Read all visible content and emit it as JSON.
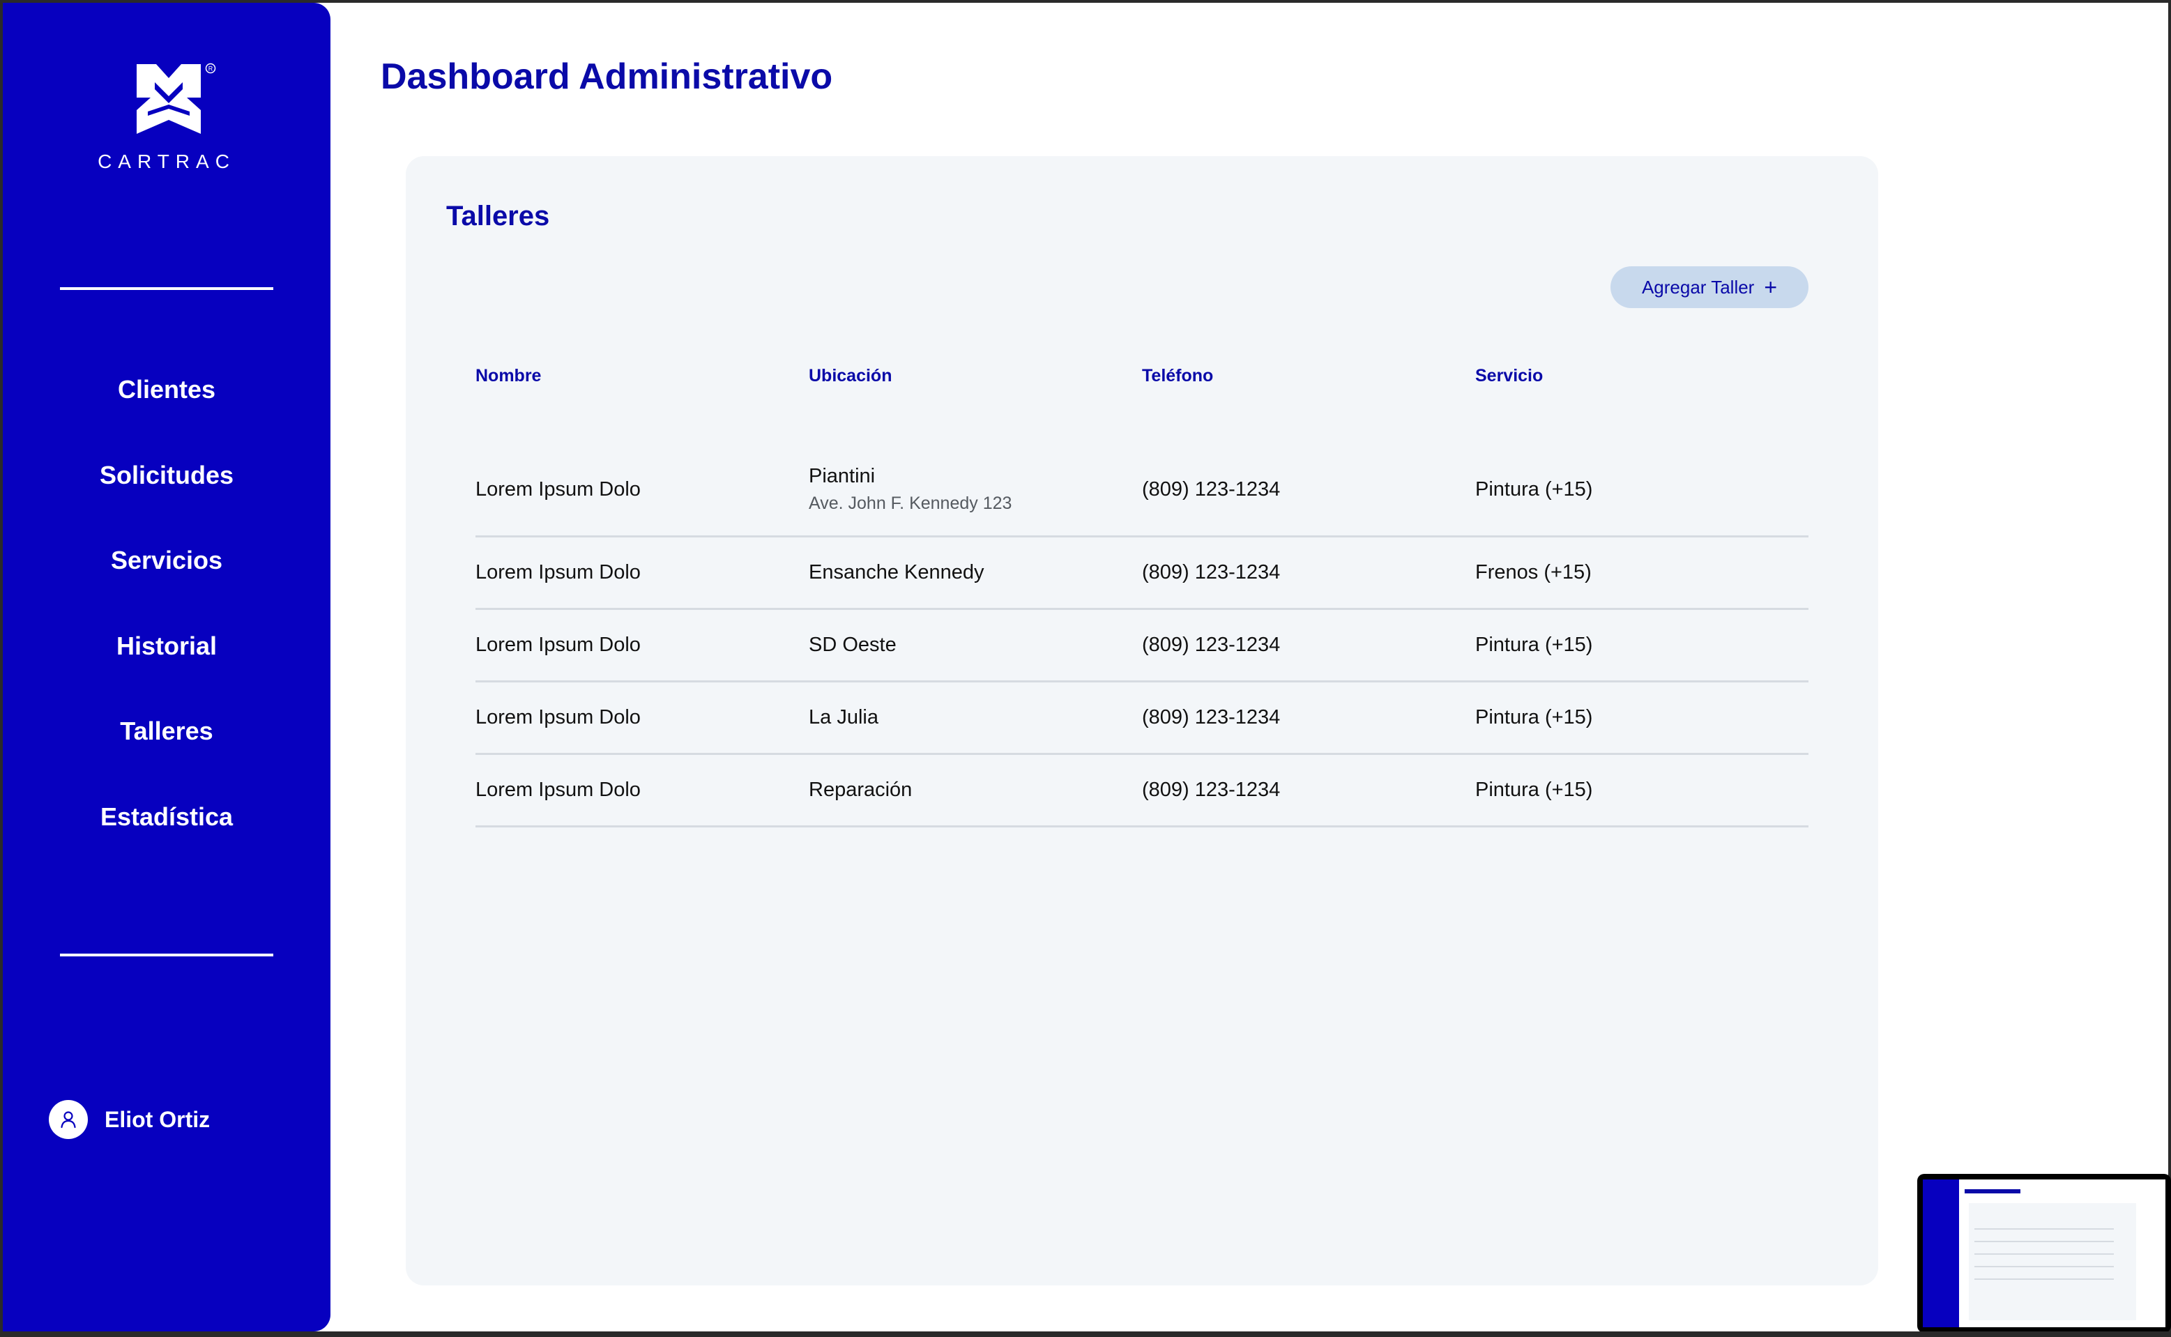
{
  "brand": {
    "name": "CARTRAC",
    "primary_color": "#0700bf",
    "accent_text_color": "#0a0aa8",
    "logo_icon": "cartrac-logo-icon"
  },
  "page": {
    "title": "Dashboard Administrativo"
  },
  "sidebar": {
    "items": [
      {
        "label": "Clientes"
      },
      {
        "label": "Solicitudes"
      },
      {
        "label": "Servicios"
      },
      {
        "label": "Historial"
      },
      {
        "label": "Talleres"
      },
      {
        "label": "Estadística"
      }
    ],
    "user": {
      "name": "Eliot Ortiz",
      "icon": "user-icon"
    }
  },
  "section": {
    "title": "Talleres",
    "add_button_label": "Agregar Taller",
    "add_button_icon": "plus-icon"
  },
  "table": {
    "headers": [
      "Nombre",
      "Ubicación",
      "Teléfono",
      "Servicio"
    ],
    "rows": [
      {
        "nombre": "Lorem Ipsum Dolo",
        "ubicacion": "Piantini",
        "ubicacion_detalle": "Ave. John F. Kennedy 123",
        "telefono": "(809) 123-1234",
        "servicio": "Pintura (+15)"
      },
      {
        "nombre": "Lorem Ipsum Dolo",
        "ubicacion": "Ensanche Kennedy",
        "telefono": "(809) 123-1234",
        "servicio": "Frenos (+15)"
      },
      {
        "nombre": "Lorem Ipsum Dolo",
        "ubicacion": "SD Oeste",
        "telefono": "(809) 123-1234",
        "servicio": "Pintura (+15)"
      },
      {
        "nombre": "Lorem Ipsum Dolo",
        "ubicacion": "La Julia",
        "telefono": "(809) 123-1234",
        "servicio": "Pintura (+15)"
      },
      {
        "nombre": "Lorem Ipsum Dolo",
        "ubicacion": "Reparación",
        "telefono": "(809) 123-1234",
        "servicio": "Pintura (+15)"
      }
    ]
  }
}
